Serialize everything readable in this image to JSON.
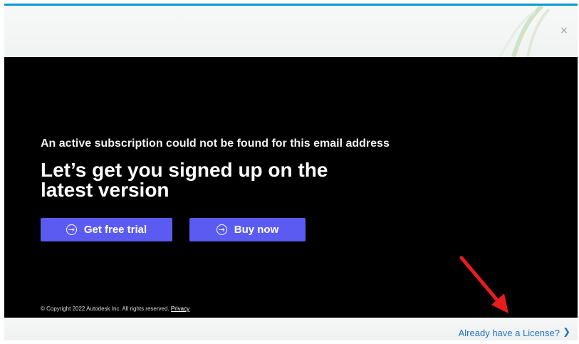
{
  "dialog": {
    "close_glyph": "×",
    "subtitle": "An active subscription could not be found for this email address",
    "headline": "Let’s get you signed up on the latest version",
    "buttons": {
      "trial_label": "Get free trial",
      "buy_label": "Buy now"
    },
    "copyright_text": "© Copyright 2022 Autodesk Inc. All rights reserved.",
    "privacy_link": "Privacy",
    "license_link": "Already have a License?"
  },
  "colors": {
    "accent_bar": "#0696d7",
    "button": "#5b5bf2",
    "link": "#1f72c4",
    "annotation_arrow": "#e81c1c"
  },
  "icons": [
    "close-icon",
    "arrow-circle-right-icon",
    "chevron-right-icon",
    "red-pointer-arrow"
  ]
}
